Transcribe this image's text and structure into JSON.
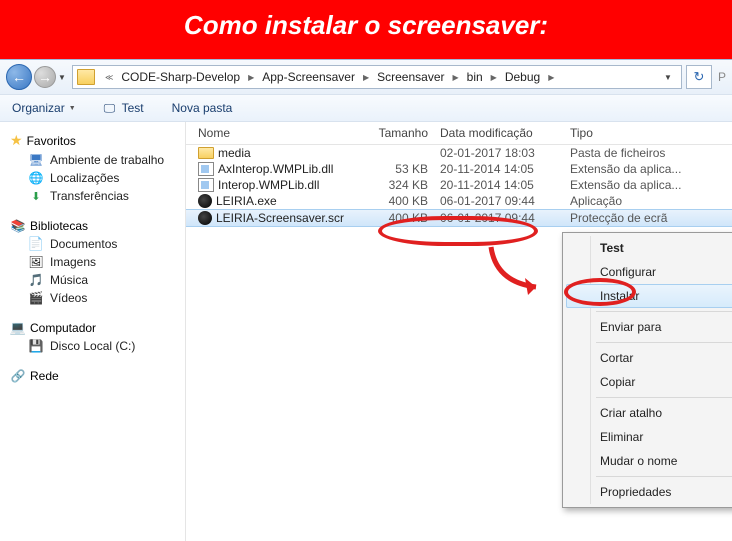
{
  "banner": "Como instalar o screensaver:",
  "breadcrumbs": [
    "CODE-Sharp-Develop",
    "App-Screensaver",
    "Screensaver",
    "bin",
    "Debug"
  ],
  "search_cut": "P",
  "toolbar": {
    "organize": "Organizar",
    "test": "Test",
    "newfolder": "Nova pasta"
  },
  "sidebar": {
    "favorites": {
      "label": "Favoritos",
      "items": [
        "Ambiente de trabalho",
        "Localizações",
        "Transferências"
      ]
    },
    "libraries": {
      "label": "Bibliotecas",
      "items": [
        "Documentos",
        "Imagens",
        "Música",
        "Vídeos"
      ]
    },
    "computer": {
      "label": "Computador",
      "items": [
        "Disco Local (C:)"
      ]
    },
    "network": {
      "label": "Rede"
    }
  },
  "columns": {
    "name": "Nome",
    "size": "Tamanho",
    "modified": "Data modificação",
    "type": "Tipo"
  },
  "files": [
    {
      "name": "media",
      "size": "",
      "date": "02-01-2017 18:03",
      "type": "Pasta de ficheiros",
      "icon": "folder"
    },
    {
      "name": "AxInterop.WMPLib.dll",
      "size": "53 KB",
      "date": "20-11-2014 14:05",
      "type": "Extensão da aplica...",
      "icon": "dll"
    },
    {
      "name": "Interop.WMPLib.dll",
      "size": "324 KB",
      "date": "20-11-2014 14:05",
      "type": "Extensão da aplica...",
      "icon": "dll"
    },
    {
      "name": "LEIRIA.exe",
      "size": "400 KB",
      "date": "06-01-2017 09:44",
      "type": "Aplicação",
      "icon": "exe"
    },
    {
      "name": "LEIRIA-Screensaver.scr",
      "size": "400 KB",
      "date": "06-01-2017 09:44",
      "type": "Protecção de ecrã",
      "icon": "exe",
      "selected": true
    }
  ],
  "context": {
    "test": "Test",
    "config": "Configurar",
    "install": "Instalar",
    "sendto": "Enviar para",
    "cut": "Cortar",
    "copy": "Copiar",
    "shortcut": "Criar atalho",
    "delete": "Eliminar",
    "rename": "Mudar o nome",
    "props": "Propriedades"
  }
}
